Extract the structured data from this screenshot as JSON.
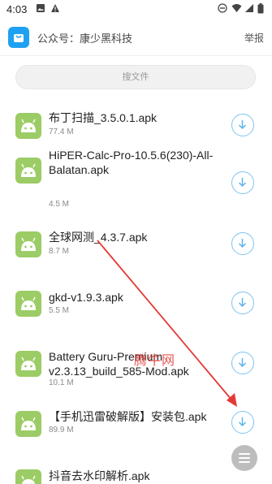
{
  "status_bar": {
    "time": "4:03",
    "icons_left": [
      "image-icon",
      "warning-icon"
    ],
    "icons_right": [
      "dnd-icon",
      "wifi-icon",
      "signal-icon",
      "battery-icon"
    ]
  },
  "header": {
    "title": "公众号：康少黑科技",
    "report_label": "举报"
  },
  "search": {
    "placeholder": "搜文件"
  },
  "files": [
    {
      "name": "布丁扫描_3.5.0.1.apk",
      "size": "77.4 M"
    },
    {
      "name": "HiPER-Calc-Pro-10.5.6(230)-All-Balatan.apk",
      "size": "4.5 M"
    },
    {
      "name": "全球网测_4.3.7.apk",
      "size": "8.7 M"
    },
    {
      "name": "gkd-v1.9.3.apk",
      "size": "5.5 M"
    },
    {
      "name": "Battery Guru-Premium v2.3.13_build_585-Mod.apk",
      "size": "10.1 M"
    },
    {
      "name": "【手机迅雷破解版】安装包.apk",
      "size": "89.9 M"
    },
    {
      "name": "抖音去水印解析.apk",
      "size": ""
    }
  ],
  "watermark": "腾牛网",
  "colors": {
    "accent": "#1ea1f2",
    "apk_icon": "#9ccc65",
    "annotation_arrow": "#e53935"
  }
}
